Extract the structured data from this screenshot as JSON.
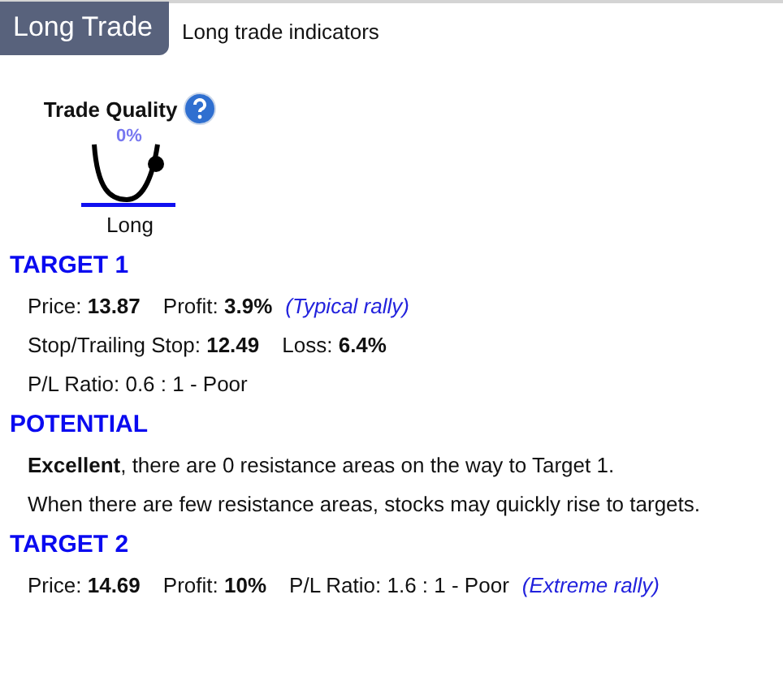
{
  "tab": {
    "label": "Long Trade",
    "selected": true
  },
  "subtitle": "Long trade indicators",
  "quality": {
    "title": "Trade Quality",
    "percent": "0%",
    "caption": "Long"
  },
  "sections": [
    {
      "heading": "TARGET 1",
      "lines": [
        [
          {
            "kind": "pair",
            "label": "Price:",
            "value": "13.87"
          },
          {
            "kind": "pair",
            "label": "Profit:",
            "value": "3.9%"
          },
          {
            "kind": "note",
            "text": "(Typical rally)"
          }
        ],
        [
          {
            "kind": "pair",
            "label": "Stop/Trailing Stop:",
            "value": "12.49"
          },
          {
            "kind": "pair",
            "label": "Loss:",
            "value": "6.4%"
          }
        ],
        [
          {
            "kind": "text",
            "text": "P/L Ratio: 0.6 : 1 - Poor"
          }
        ]
      ]
    },
    {
      "heading": "POTENTIAL",
      "lines": [
        [
          {
            "kind": "text",
            "text": "**Excellent**, there are 0 resistance areas on the way to Target 1."
          }
        ],
        [
          {
            "kind": "text",
            "text": "When there are few resistance areas, stocks may quickly rise to targets."
          }
        ]
      ]
    },
    {
      "heading": "TARGET 2",
      "lines": [
        [
          {
            "kind": "pair",
            "label": "Price:",
            "value": "14.69"
          },
          {
            "kind": "pair",
            "label": "Profit:",
            "value": "10%"
          },
          {
            "kind": "text",
            "text": "P/L Ratio: 1.6 : 1 - Poor"
          },
          {
            "kind": "note",
            "text": "(Extreme rally)"
          }
        ]
      ]
    }
  ]
}
